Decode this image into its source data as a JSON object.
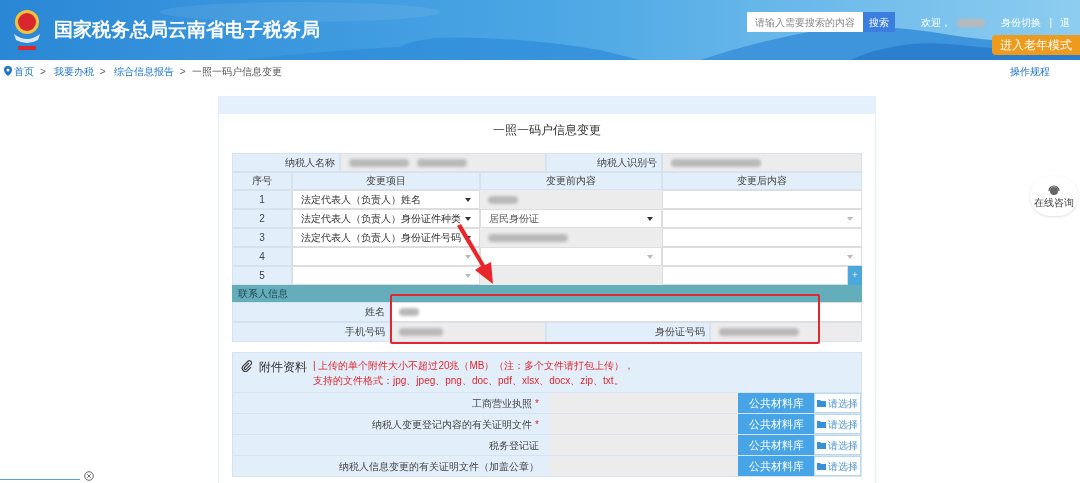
{
  "header": {
    "title": "国家税务总局云南省电子税务局",
    "search": {
      "placeholder": "请输入需要搜索的内容",
      "button": "搜索"
    },
    "welcome": "欢迎，",
    "switch_identity": "身份切换",
    "separator": "|",
    "logout": "退",
    "elder_mode": "进入老年模式"
  },
  "breadcrumb": [
    {
      "label": "首页",
      "link": true
    },
    {
      "separator": ">",
      "label": "我要办税",
      "link": true
    },
    {
      "separator": ">",
      "label": "综合信息报告",
      "link": true
    },
    {
      "separator": ">",
      "label": "一照一码户信息变更",
      "link": false
    }
  ],
  "help_link": "操作规程",
  "form": {
    "title": "一照一码户信息变更",
    "taxpayer_name_label": "纳税人名称",
    "taxpayer_id_label": "纳税人识别号",
    "columns": [
      "序号",
      "变更项目",
      "变更前内容",
      "变更后内容"
    ],
    "rows": [
      {
        "seq": "1",
        "item": "法定代表人（负责人）姓名",
        "before": {
          "kind": "readonly",
          "blurred": true
        },
        "after": {
          "kind": "input"
        }
      },
      {
        "seq": "2",
        "item": "法定代表人（负责人）身份证件种类",
        "before": {
          "kind": "select",
          "value": "居民身份证"
        },
        "after": {
          "kind": "select"
        }
      },
      {
        "seq": "3",
        "item": "法定代表人（负责人）身份证件号码",
        "before": {
          "kind": "readonly",
          "blurred": true
        },
        "after": {
          "kind": "input"
        }
      },
      {
        "seq": "4",
        "before": {
          "kind": "select"
        },
        "after": {
          "kind": "select"
        }
      },
      {
        "seq": "5",
        "before": {
          "kind": "readonly",
          "blurred": false
        },
        "after": {
          "kind": "input",
          "add_button": "+"
        }
      }
    ],
    "contact": {
      "heading": "联系人信息",
      "name_label": "姓名",
      "phone_label": "手机号码",
      "id_label": "身份证号码"
    }
  },
  "attachments": {
    "title": "附件资料",
    "notice": "| 上传的单个附件大小不超过20兆（MB）（注：多个文件请打包上传），支持的文件格式：jpg、jpeg、png、doc、pdf、xlsx、docx、zip、txt。",
    "items": [
      {
        "label": "工商营业执照",
        "required_mark": "*",
        "library_button": "公共材料库",
        "choose_button": "请选择"
      },
      {
        "label": "纳税人变更登记内容的有关证明文件",
        "required_mark": "*",
        "library_button": "公共材料库",
        "choose_button": "请选择"
      },
      {
        "label": "税务登记证",
        "library_button": "公共材料库",
        "choose_button": "请选择"
      },
      {
        "label": "纳税人信息变更的有关证明文件（加盖公章）",
        "library_button": "公共材料库",
        "choose_button": "请选择"
      }
    ]
  },
  "consult": "在线咨询"
}
